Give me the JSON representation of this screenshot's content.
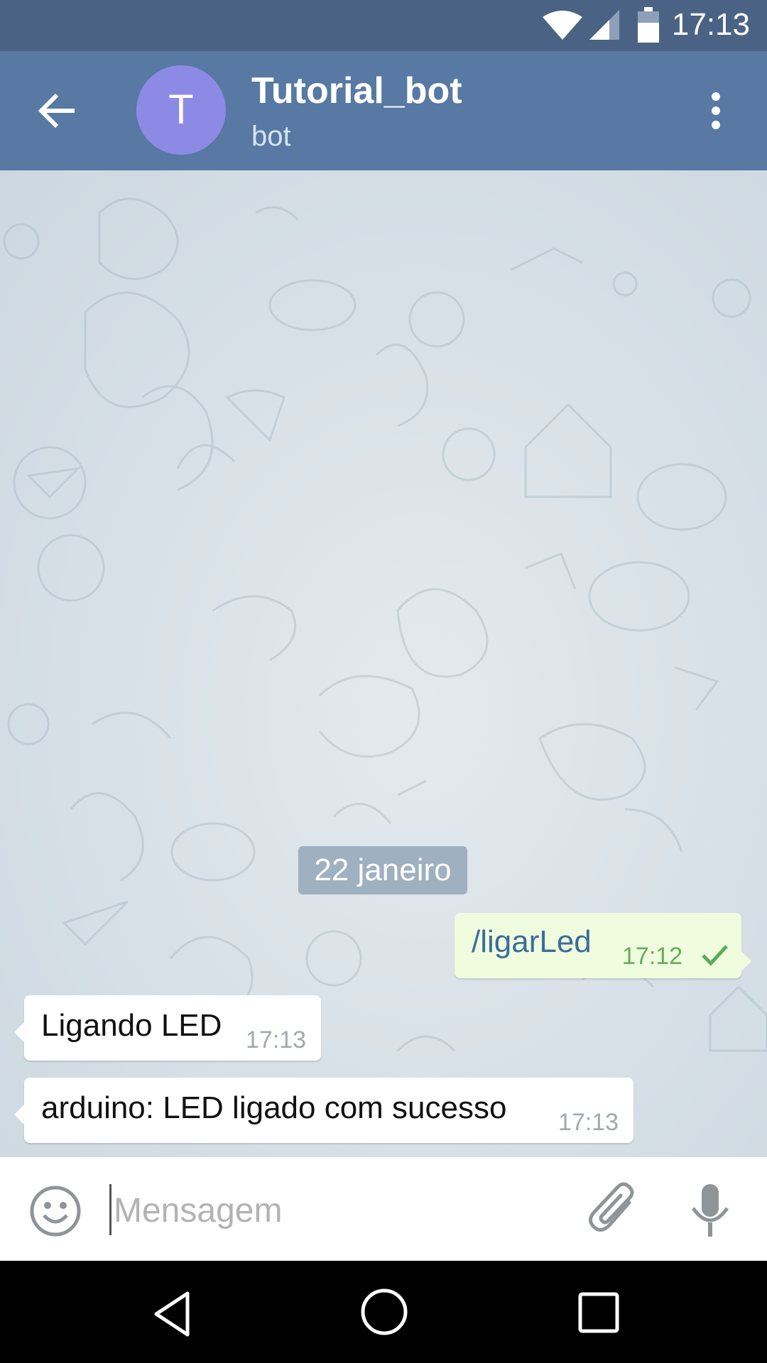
{
  "status_bar": {
    "time": "17:13",
    "icons": [
      "wifi-icon",
      "signal-icon",
      "battery-icon"
    ]
  },
  "header": {
    "avatar_letter": "T",
    "title": "Tutorial_bot",
    "subtitle": "bot",
    "colors": {
      "bar": "#5779a3",
      "avatar": "#8d8ae6"
    }
  },
  "chat": {
    "date_separator": "22 janeiro",
    "messages": [
      {
        "direction": "out",
        "text": "/ligarLed",
        "time": "17:12",
        "status": "sent-check"
      },
      {
        "direction": "in",
        "text": "Ligando LED",
        "time": "17:13"
      },
      {
        "direction": "in",
        "text": "arduino: LED ligado com sucesso",
        "time": "17:13"
      }
    ]
  },
  "composer": {
    "placeholder": "Mensagem",
    "value": ""
  }
}
